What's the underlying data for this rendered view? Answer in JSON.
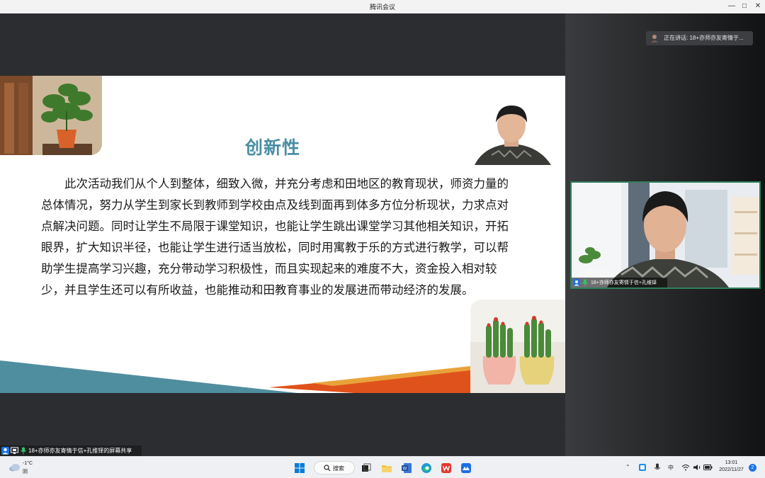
{
  "window": {
    "title": "腾讯会议"
  },
  "slide": {
    "title": "创新性",
    "body": "此次活动我们从个人到整体，细致入微，并充分考虑和田地区的教育现状，师资力量的总体情况，努力从学生到家长到教师到学校由点及线到面再到体多方位分析现状，力求点对点解决问题。同时让学生不局限于课堂知识，也能让学生跳出课堂学习其他相关知识，开拓眼界，扩大知识半径，也能让学生进行适当放松，同时用寓教于乐的方式进行教学，可以帮助学生提高学习兴趣，充分带动学习积极性，而且实现起来的难度不大，资金投入相对较少，并且学生还可以有所收益，也能推动和田教育事业的发展进而带动经济的发展。",
    "title_color": "#4a8ea4"
  },
  "speaking": {
    "label": "正在讲话: 18+亦师亦友寄情于..."
  },
  "video": {
    "participant_name": "18+亦师亦友寄情于信+孔维铎"
  },
  "share_status": {
    "label": "18+亦师亦友寄情于信+孔维铎的屏幕共享"
  },
  "taskbar": {
    "weather_temp": "-1°C",
    "weather_cond": "阴",
    "search_label": "搜索",
    "ime": "中",
    "time": "13:01",
    "date": "2022/11/27",
    "notifications": "2"
  },
  "colors": {
    "accent": "#1a73e8",
    "video_border": "#2f7f5b",
    "stripe_teal": "#4f8e9e",
    "stripe_orange": "#e0521b"
  }
}
